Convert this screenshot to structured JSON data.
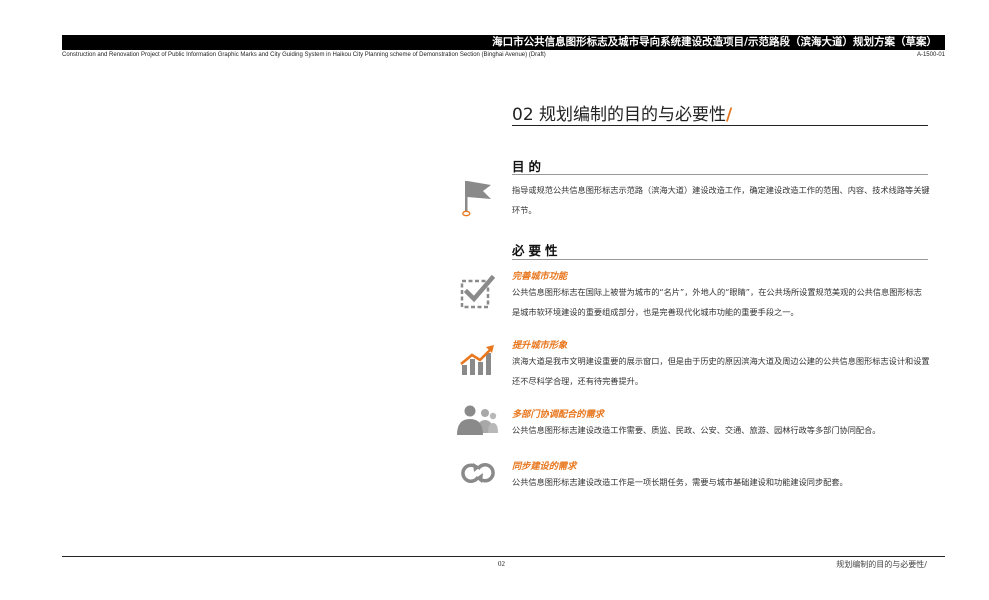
{
  "header": {
    "title": "海口市公共信息图形标志及城市导向系统建设改造项目/示范路段（滨海大道）规划方案（草案）",
    "subtitle": "Construction and Renovation Project of Public Information Graphic Marks and City Guiding System in Haikou City Planning scheme of Demonstration Section (Binghai Avenue) (Draft)",
    "code": "A-1500-01"
  },
  "page": {
    "title": "02 规划编制的目的与必要性",
    "title_slash": "/"
  },
  "purpose": {
    "heading": "目的",
    "icon": "flag-icon",
    "text": "指导或规范公共信息图形标志示范路（滨海大道）建设改造工作，确定建设改造工作的范围、内容、技术线路等关键环节。"
  },
  "necessity": {
    "heading": "必要性",
    "items": [
      {
        "icon": "checkbox-icon",
        "title": "完善城市功能",
        "text": "公共信息图形标志在国际上被誉为城市的“名片”，外地人的“眼睛”，在公共场所设置规范美观的公共信息图形标志是城市软环境建设的重要组成部分，也是完善现代化城市功能的重要手段之一。"
      },
      {
        "icon": "growth-chart-icon",
        "title": "提升城市形象",
        "text": "滨海大道是我市文明建设重要的展示窗口，但是由于历史的原因滨海大道及周边公建的公共信息图形标志设计和设置还不尽科学合理，还有待完善提升。"
      },
      {
        "icon": "people-group-icon",
        "title": "多部门协调配合的需求",
        "text": "公共信息图形标志建设改造工作需要、质监、民政、公安、交通、旅游、园林行政等多部门协同配合。"
      },
      {
        "icon": "sync-icon",
        "title": "同步建设的需求",
        "text": "公共信息图形标志建设改造工作是一项长期任务，需要与城市基础建设和功能建设同步配套。"
      }
    ]
  },
  "footer": {
    "page_number": "02",
    "label": "规划编制的目的与必要性/"
  },
  "colors": {
    "accent": "#e8771e",
    "icon_gray": "#8a8a8a"
  }
}
